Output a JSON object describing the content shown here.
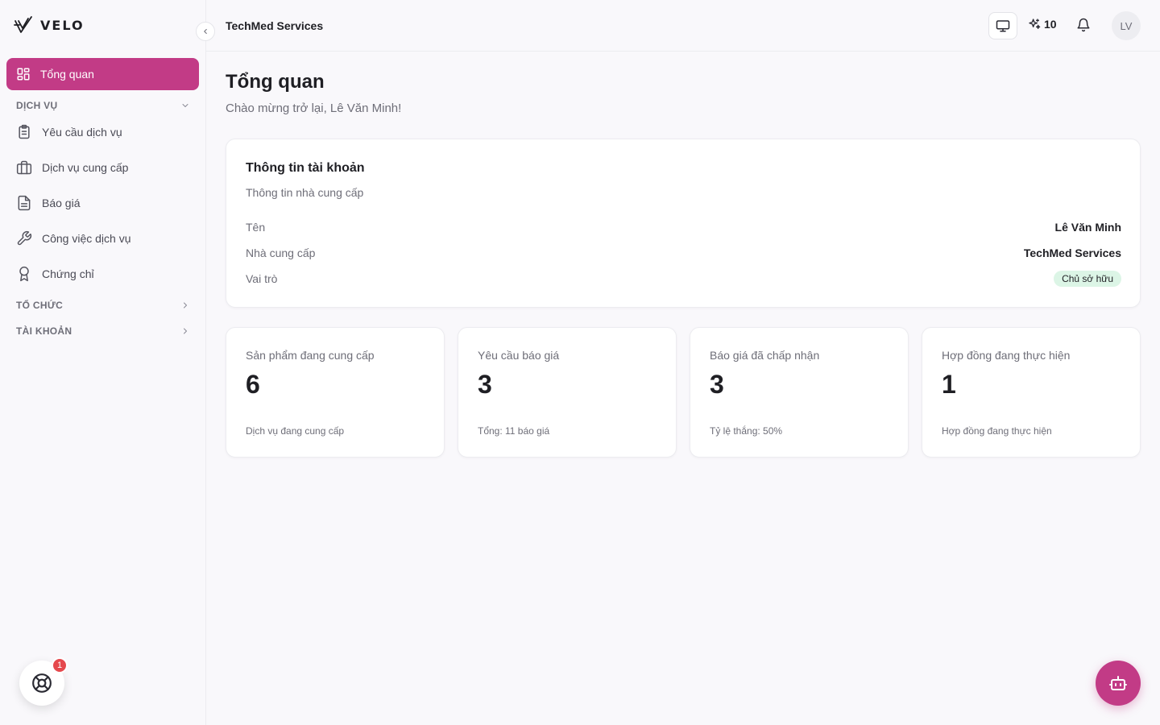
{
  "brand": {
    "name": "VELO",
    "logo_icon": "velo-logo-icon"
  },
  "topbar": {
    "org_name": "TechMed Services",
    "credits": "10",
    "avatar_initials": "LV"
  },
  "sidebar": {
    "active_item": {
      "label": "Tổng quan",
      "icon": "grid-icon"
    },
    "sections": [
      {
        "label": "DỊCH VỤ",
        "expanded": true
      },
      {
        "label": "TỔ CHỨC",
        "expanded": false
      },
      {
        "label": "TÀI KHOẢN",
        "expanded": false
      }
    ],
    "service_items": [
      {
        "label": "Yêu cầu dịch vụ",
        "icon": "clipboard-list-icon"
      },
      {
        "label": "Dịch vụ cung cấp",
        "icon": "briefcase-icon"
      },
      {
        "label": "Báo giá",
        "icon": "file-text-icon"
      },
      {
        "label": "Công việc dịch vụ",
        "icon": "wrench-icon"
      },
      {
        "label": "Chứng chỉ",
        "icon": "award-icon"
      }
    ],
    "help_badge_count": "1"
  },
  "page": {
    "title": "Tổng quan",
    "subtitle": "Chào mừng trở lại, Lê Văn Minh!"
  },
  "account_card": {
    "title": "Thông tin tài khoản",
    "subtitle": "Thông tin nhà cung cấp",
    "rows": [
      {
        "label": "Tên",
        "value": "Lê Văn Minh"
      },
      {
        "label": "Nhà cung cấp",
        "value": "TechMed Services"
      },
      {
        "label": "Vai trò",
        "value": "Chủ sở hữu"
      }
    ]
  },
  "stats": [
    {
      "label": "Sản phẩm đang cung cấp",
      "value": "6",
      "footer": "Dịch vụ đang cung cấp"
    },
    {
      "label": "Yêu cầu báo giá",
      "value": "3",
      "footer": "Tổng: 11 báo giá"
    },
    {
      "label": "Báo giá đã chấp nhận",
      "value": "3",
      "footer": "Tỷ lệ thắng: 50%"
    },
    {
      "label": "Hợp đồng đang thực hiện",
      "value": "1",
      "footer": "Hợp đồng đang thực hiện"
    }
  ],
  "colors": {
    "accent": "#c23b86",
    "role_badge_bg": "#dcf5e6",
    "notification": "#e5484d"
  }
}
